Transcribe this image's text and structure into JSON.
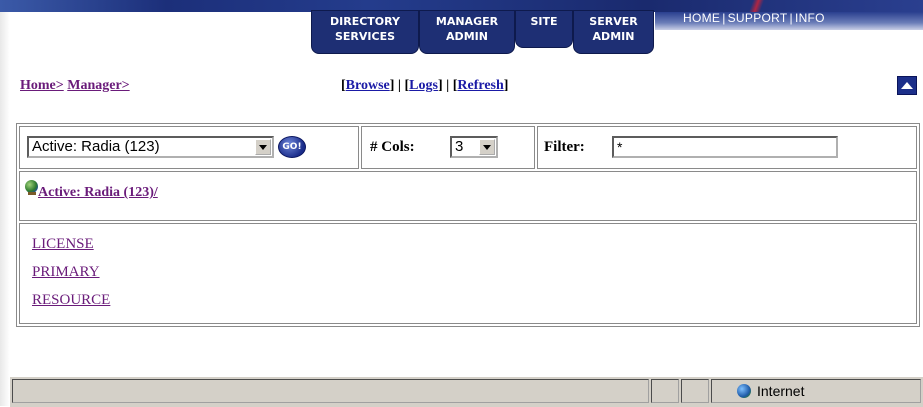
{
  "top_nav": {
    "links": [
      "HOME",
      "SUPPORT",
      "INFO"
    ],
    "separator": "|",
    "tabs": [
      {
        "line1": "DIRECTORY",
        "line2": "SERVICES"
      },
      {
        "line1": "MANAGER",
        "line2": "ADMIN"
      },
      {
        "line1": "SITE",
        "line2": ""
      },
      {
        "line1": "SERVER",
        "line2": "ADMIN"
      }
    ]
  },
  "breadcrumb": {
    "home": "Home>",
    "manager": "Manager>"
  },
  "actions": {
    "browse": "Browse",
    "logs": "Logs",
    "refresh": "Refresh"
  },
  "controls": {
    "db_select_value": "Active: Radia (123)",
    "go_label": "GO!",
    "cols_label": "# Cols:",
    "cols_value": "3",
    "filter_label": "Filter:",
    "filter_value": "*"
  },
  "path": {
    "label": "Active: Radia (123)/"
  },
  "items": [
    "LICENSE",
    "PRIMARY",
    "RESOURCE"
  ],
  "status_bar": {
    "zone": "Internet"
  }
}
